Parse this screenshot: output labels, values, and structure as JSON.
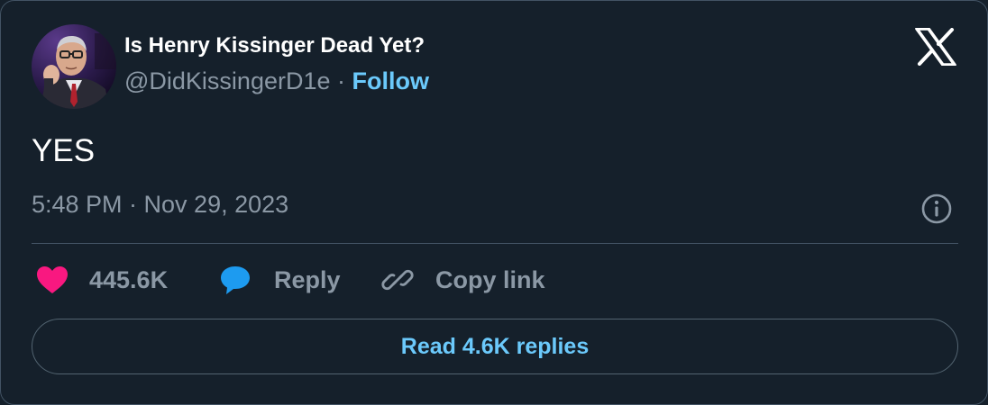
{
  "author": {
    "display_name": "Is Henry Kissinger Dead Yet?",
    "handle": "@DidKissingerD1e",
    "separator": "·",
    "follow_label": "Follow"
  },
  "tweet": {
    "text": "YES",
    "timestamp": "5:48 PM · Nov 29, 2023"
  },
  "actions": {
    "like_count": "445.6K",
    "reply_label": "Reply",
    "copy_link_label": "Copy link"
  },
  "read_replies_label": "Read 4.6K replies",
  "icons": {
    "logo": "x-logo-icon",
    "info": "info-icon",
    "like": "heart-icon",
    "reply": "speech-bubble-icon",
    "copy": "link-icon"
  },
  "colors": {
    "background": "#15202b",
    "border": "#425364",
    "text_primary": "#ffffff",
    "text_secondary": "#8b98a5",
    "link": "#6bc9fb",
    "heart": "#f91880",
    "reply_bubble": "#1d9bf0"
  }
}
